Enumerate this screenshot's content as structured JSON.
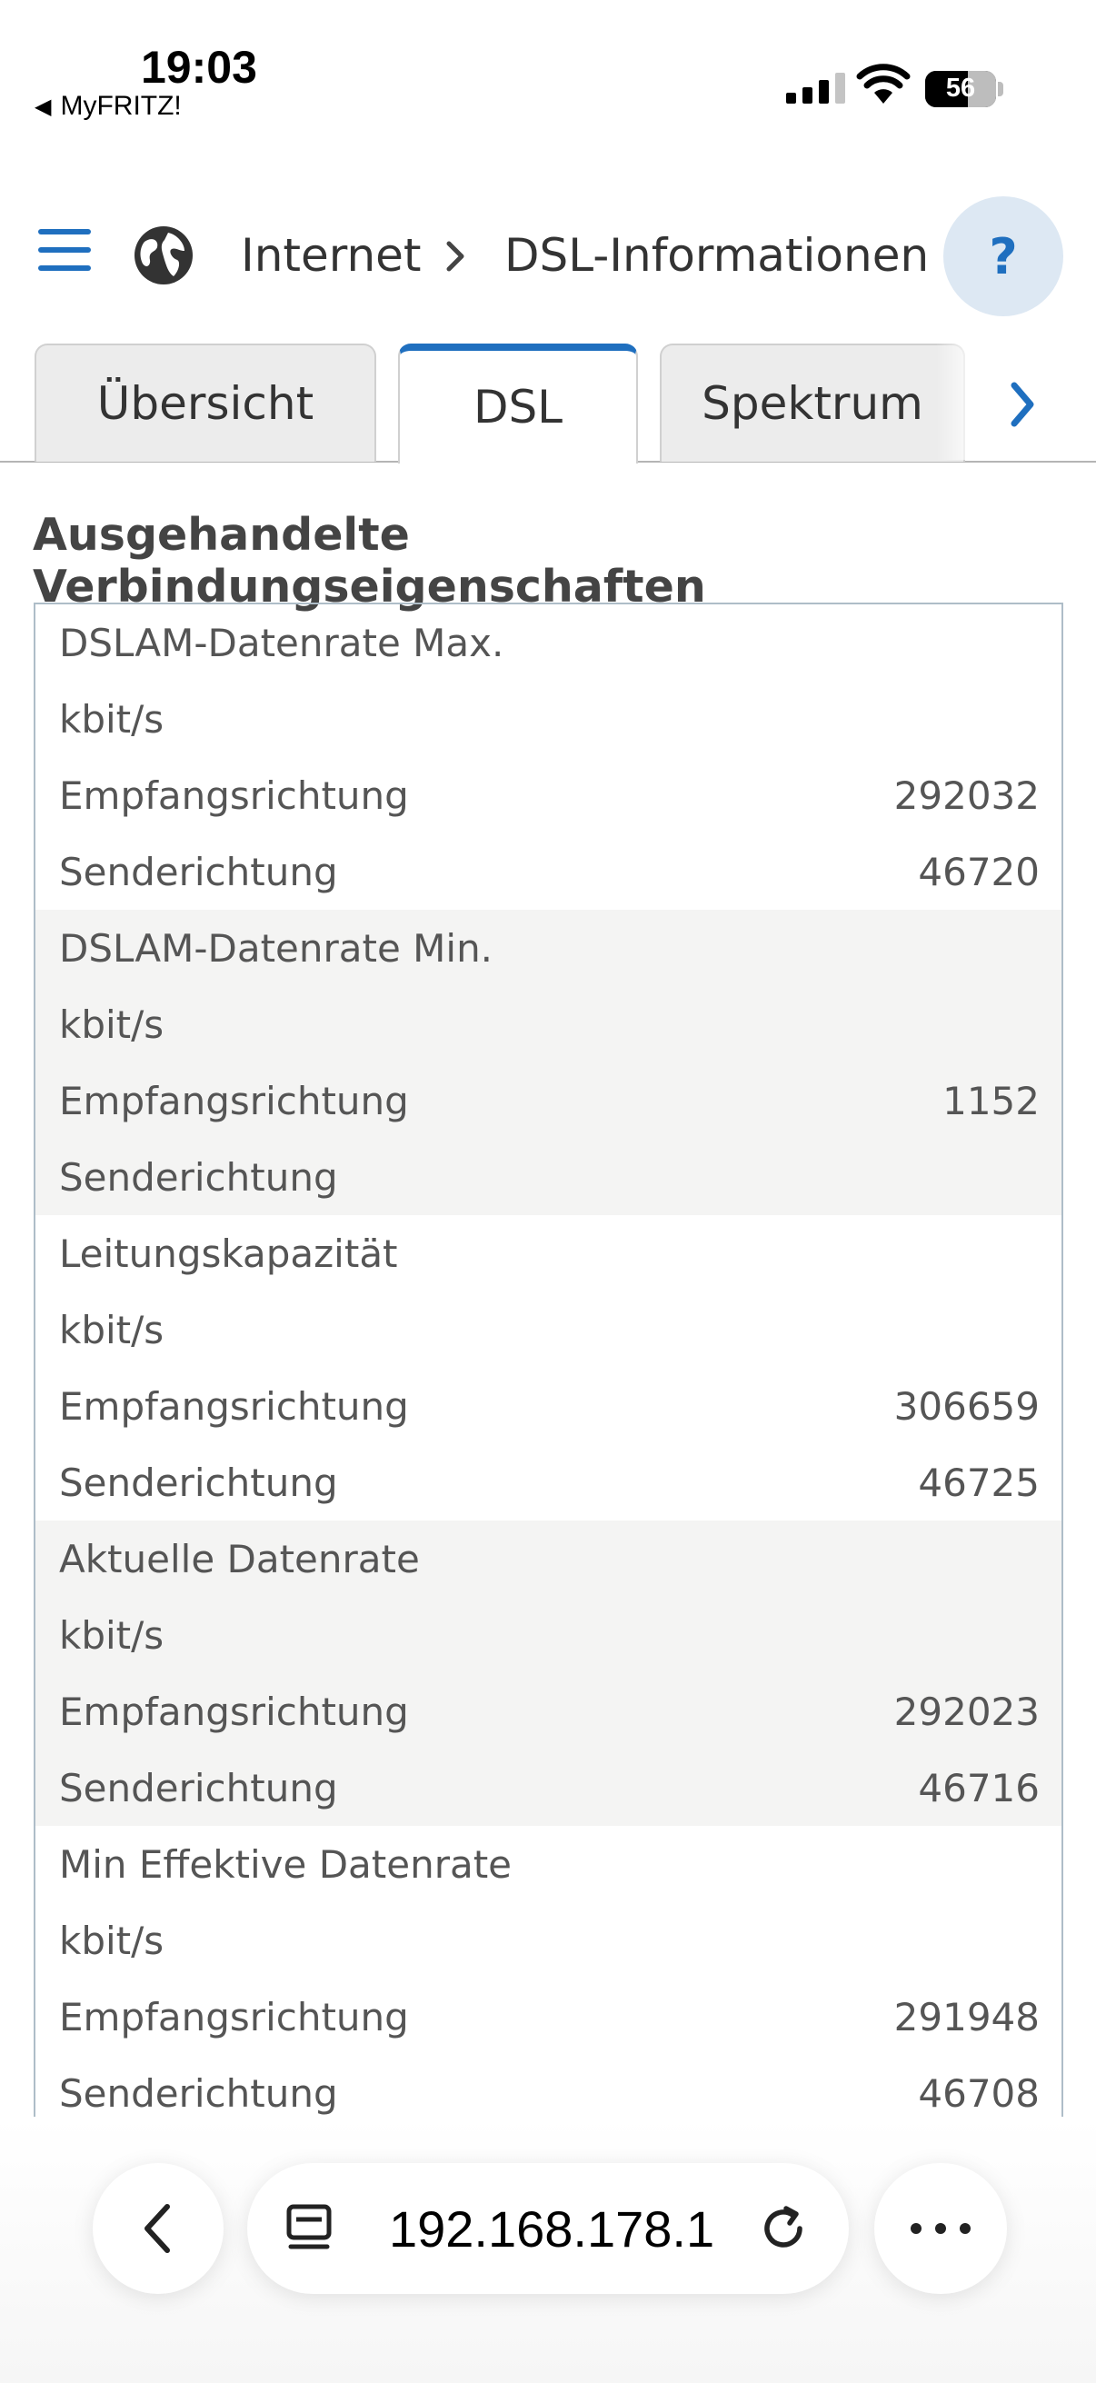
{
  "status_bar": {
    "time": "19:03",
    "back_app": "MyFRITZ!",
    "battery": "56"
  },
  "header": {
    "crumb_section": "Internet",
    "crumb_separator": ">",
    "crumb_page": "DSL-Informationen",
    "help_label": "?"
  },
  "tabs": [
    {
      "label": "Übersicht",
      "active": false
    },
    {
      "label": "DSL",
      "active": true
    },
    {
      "label": "Spektrum",
      "active": false
    }
  ],
  "section_title": "Ausgehandelte Verbindungseigenschaften",
  "groups": [
    {
      "title": "DSLAM-Datenrate Max.",
      "unit": "kbit/s",
      "rx_label": "Empfangsrichtung",
      "rx": "292032",
      "tx_label": "Senderichtung",
      "tx": "46720"
    },
    {
      "title": "DSLAM-Datenrate Min.",
      "unit": "kbit/s",
      "rx_label": "Empfangsrichtung",
      "rx": "1152",
      "tx_label": "Senderichtung",
      "tx": ""
    },
    {
      "title": "Leitungskapazität",
      "unit": "kbit/s",
      "rx_label": "Empfangsrichtung",
      "rx": "306659",
      "tx_label": "Senderichtung",
      "tx": "46725"
    },
    {
      "title": "Aktuelle Datenrate",
      "unit": "kbit/s",
      "rx_label": "Empfangsrichtung",
      "rx": "292023",
      "tx_label": "Senderichtung",
      "tx": "46716"
    },
    {
      "title": "Min Effektive Datenrate",
      "unit": "kbit/s",
      "rx_label": "Empfangsrichtung",
      "rx": "291948",
      "tx_label": "Senderichtung",
      "tx": "46708"
    }
  ],
  "browser": {
    "url": "192.168.178.1"
  },
  "colors": {
    "accent": "#1f6fbf",
    "row_alt": "#f4f4f3"
  }
}
